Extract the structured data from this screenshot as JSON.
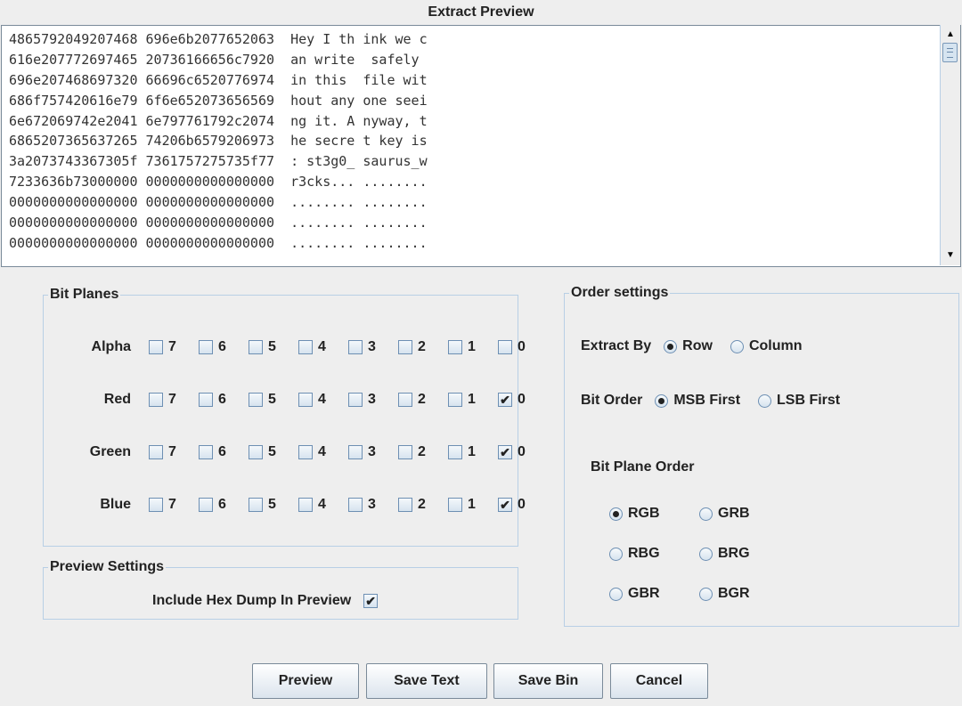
{
  "window": {
    "title": "Extract Preview"
  },
  "preview": {
    "rows": [
      "4865792049207468 696e6b2077652063  Hey I th ink we c",
      "616e207772697465 20736166656c7920  an write  safely ",
      "696e207468697320 66696c6520776974  in this  file wit",
      "686f757420616e79 6f6e652073656569  hout any one seei",
      "6e672069742e2041 6e797761792c2074  ng it. A nyway, t",
      "6865207365637265 74206b6579206973  he secre t key is",
      "3a2073743367305f 7361757275735f77  : st3g0_ saurus_w",
      "7233636b73000000 0000000000000000  r3cks... ........",
      "0000000000000000 0000000000000000  ........ ........",
      "0000000000000000 0000000000000000  ........ ........",
      "0000000000000000 0000000000000000  ........ ........"
    ]
  },
  "bit_planes": {
    "legend": "Bit Planes",
    "bits": [
      "7",
      "6",
      "5",
      "4",
      "3",
      "2",
      "1",
      "0"
    ],
    "channels": [
      {
        "name": "Alpha",
        "checked": [
          false,
          false,
          false,
          false,
          false,
          false,
          false,
          false
        ]
      },
      {
        "name": "Red",
        "checked": [
          false,
          false,
          false,
          false,
          false,
          false,
          false,
          true
        ]
      },
      {
        "name": "Green",
        "checked": [
          false,
          false,
          false,
          false,
          false,
          false,
          false,
          true
        ]
      },
      {
        "name": "Blue",
        "checked": [
          false,
          false,
          false,
          false,
          false,
          false,
          false,
          true
        ]
      }
    ]
  },
  "preview_settings": {
    "legend": "Preview Settings",
    "hex_dump_label": "Include Hex Dump In Preview",
    "hex_dump_checked": true
  },
  "order_settings": {
    "legend": "Order settings",
    "extract_by_label": "Extract By",
    "extract_by_options": [
      "Row",
      "Column"
    ],
    "extract_by_selected": "Row",
    "bit_order_label": "Bit Order",
    "bit_order_options": [
      "MSB First",
      "LSB First"
    ],
    "bit_order_selected": "MSB First",
    "plane_order_label": "Bit Plane Order",
    "plane_order_options": [
      "RGB",
      "GRB",
      "RBG",
      "BRG",
      "GBR",
      "BGR"
    ],
    "plane_order_selected": "RGB"
  },
  "buttons": {
    "preview": "Preview",
    "save_text": "Save Text",
    "save_bin": "Save Bin",
    "cancel": "Cancel"
  },
  "icons": {
    "scroll_up": "▲",
    "scroll_down": "▼",
    "check": "✔"
  }
}
